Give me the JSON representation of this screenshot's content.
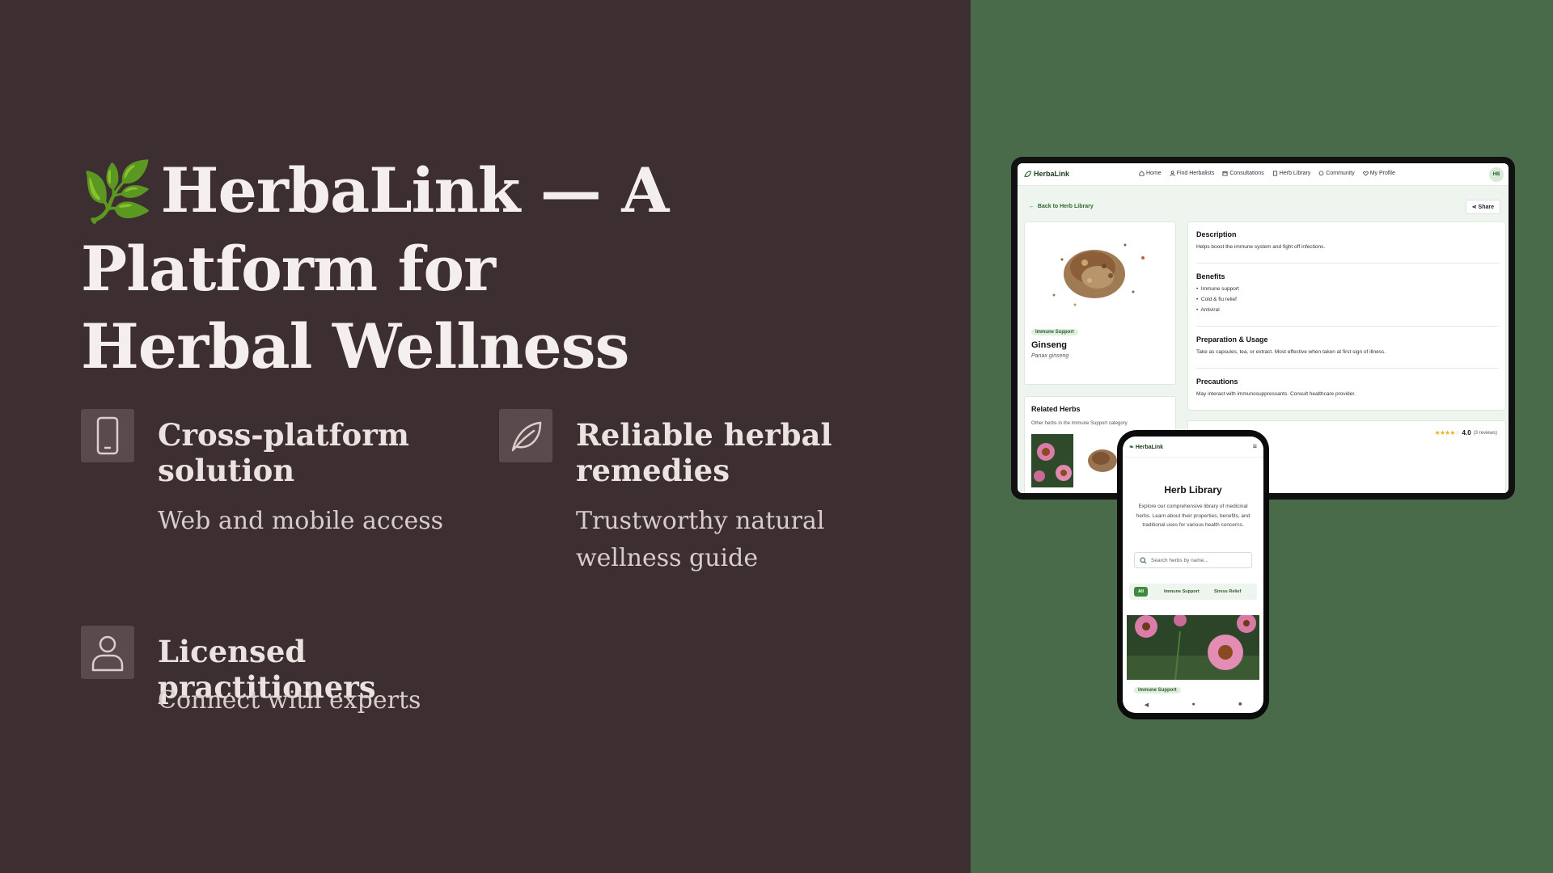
{
  "hero": {
    "emoji": "🌿",
    "title": "HerbaLink — A Platform for Herbal Wellness"
  },
  "features": [
    {
      "icon": "smartphone-icon",
      "title": "Cross-platform solution",
      "desc": "Web and mobile access"
    },
    {
      "icon": "leaf-icon",
      "title": "Reliable herbal remedies",
      "desc": "Trustworthy natural wellness guide"
    },
    {
      "icon": "user-icon",
      "title": "Licensed practitioners",
      "desc": "Connect with experts"
    }
  ],
  "colors": {
    "left_bg": "#3d2e32",
    "right_bg": "#4a6b4a",
    "accent_green": "#3f8a3f"
  },
  "tablet": {
    "brand": "HerbaLink",
    "nav": [
      "Home",
      "Find Herbalists",
      "Consultations",
      "Herb Library",
      "Community",
      "My Profile"
    ],
    "avatar": "HB",
    "back_link": "Back to Herb Library",
    "share": "Share",
    "herb": {
      "tag": "Immune Support",
      "name": "Ginseng",
      "latin": "Panax ginseng"
    },
    "sections": {
      "description_title": "Description",
      "description_text": "Helps boost the immune system and fight off infections.",
      "benefits_title": "Benefits",
      "benefits": [
        "Immune support",
        "Cold & flu relief",
        "Antiviral"
      ],
      "prep_title": "Preparation & Usage",
      "prep_text": "Take as capsules, tea, or extract. Most effective when taken at first sign of illness.",
      "precautions_title": "Precautions",
      "precautions_text": "May interact with immunosuppressants. Consult healthcare provider."
    },
    "related": {
      "title": "Related Herbs",
      "subtitle": "Other herbs in the Immune Support category"
    },
    "rating": {
      "stars": 4,
      "value": "4.0",
      "reviews": "(3 reviews)"
    }
  },
  "phone": {
    "brand": "HerbaLink",
    "menu": "≡",
    "title": "Herb Library",
    "desc": "Explore our comprehensive library of medicinal herbs. Learn about their properties, benefits, and traditional uses for various health concerns.",
    "search_placeholder": "Search herbs by name...",
    "filters": [
      "All",
      "Immune Support",
      "Stress Relief"
    ],
    "card_tag": "Immune Support",
    "sys": [
      "◀",
      "●",
      "■"
    ]
  }
}
